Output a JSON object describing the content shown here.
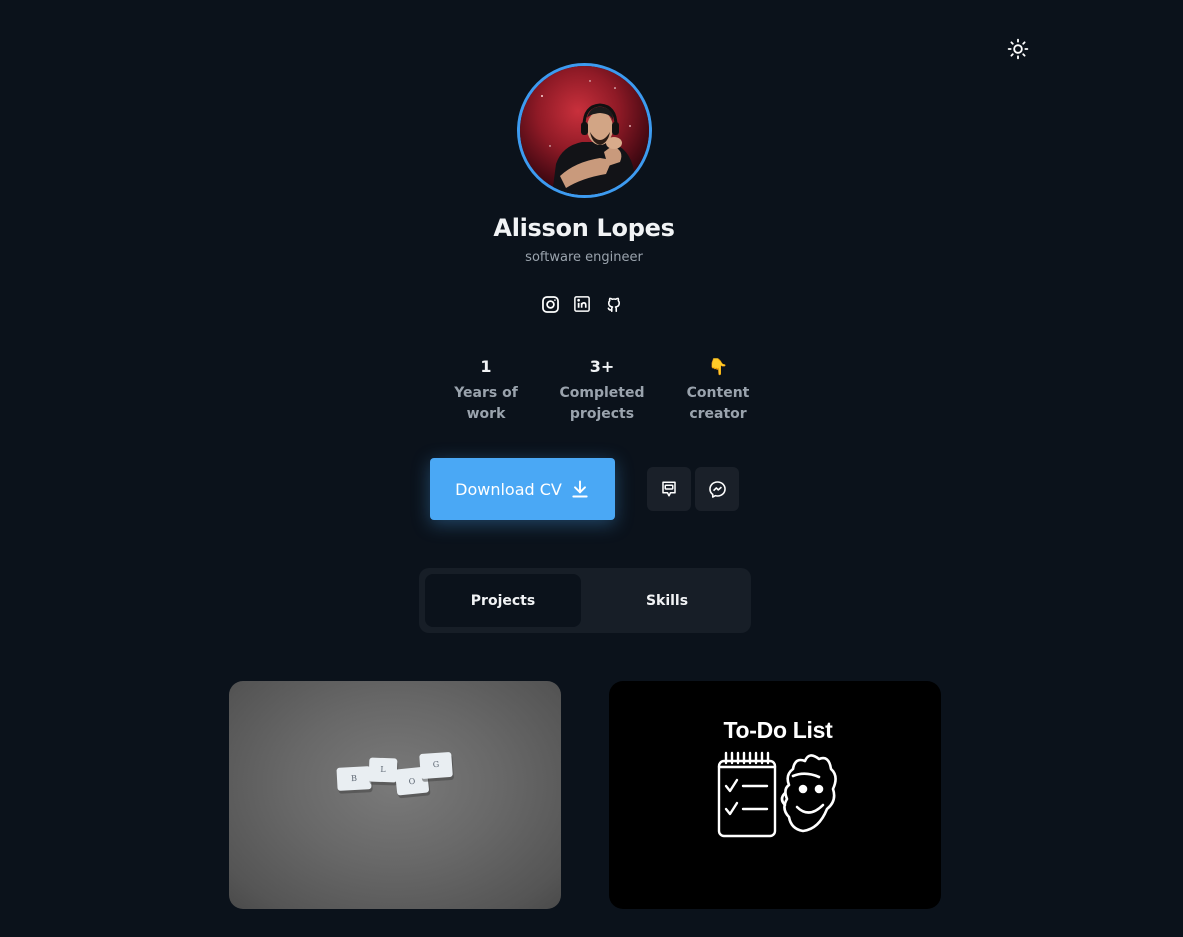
{
  "profile": {
    "name": "Alisson Lopes",
    "role": "software engineer",
    "avatar_alt": "avatar"
  },
  "header": {
    "theme_toggle_icon": "sun-icon"
  },
  "socials": [
    {
      "icon": "instagram-icon"
    },
    {
      "icon": "linkedin-icon"
    },
    {
      "icon": "github-icon"
    }
  ],
  "stats": [
    {
      "value": "1",
      "label": "Years of\nwork"
    },
    {
      "value": "3+",
      "label": "Completed\nprojects"
    },
    {
      "value": "👇",
      "label": "Content\ncreator"
    }
  ],
  "actions": {
    "download_label": "Download CV",
    "download_icon": "download-icon",
    "contact_icons": [
      "chat-icon",
      "messenger-icon"
    ]
  },
  "tabs": [
    {
      "label": "Projects",
      "active": true
    },
    {
      "label": "Skills",
      "active": false
    }
  ],
  "projects": [
    {
      "image_letters": [
        "B",
        "L",
        "O",
        "G"
      ]
    },
    {
      "title": "To-Do List"
    }
  ],
  "colors": {
    "background": "#0b121b",
    "accent": "#4aa8f5",
    "avatar_ring": "#3d9bf0",
    "muted_text": "#9aa3ad"
  }
}
